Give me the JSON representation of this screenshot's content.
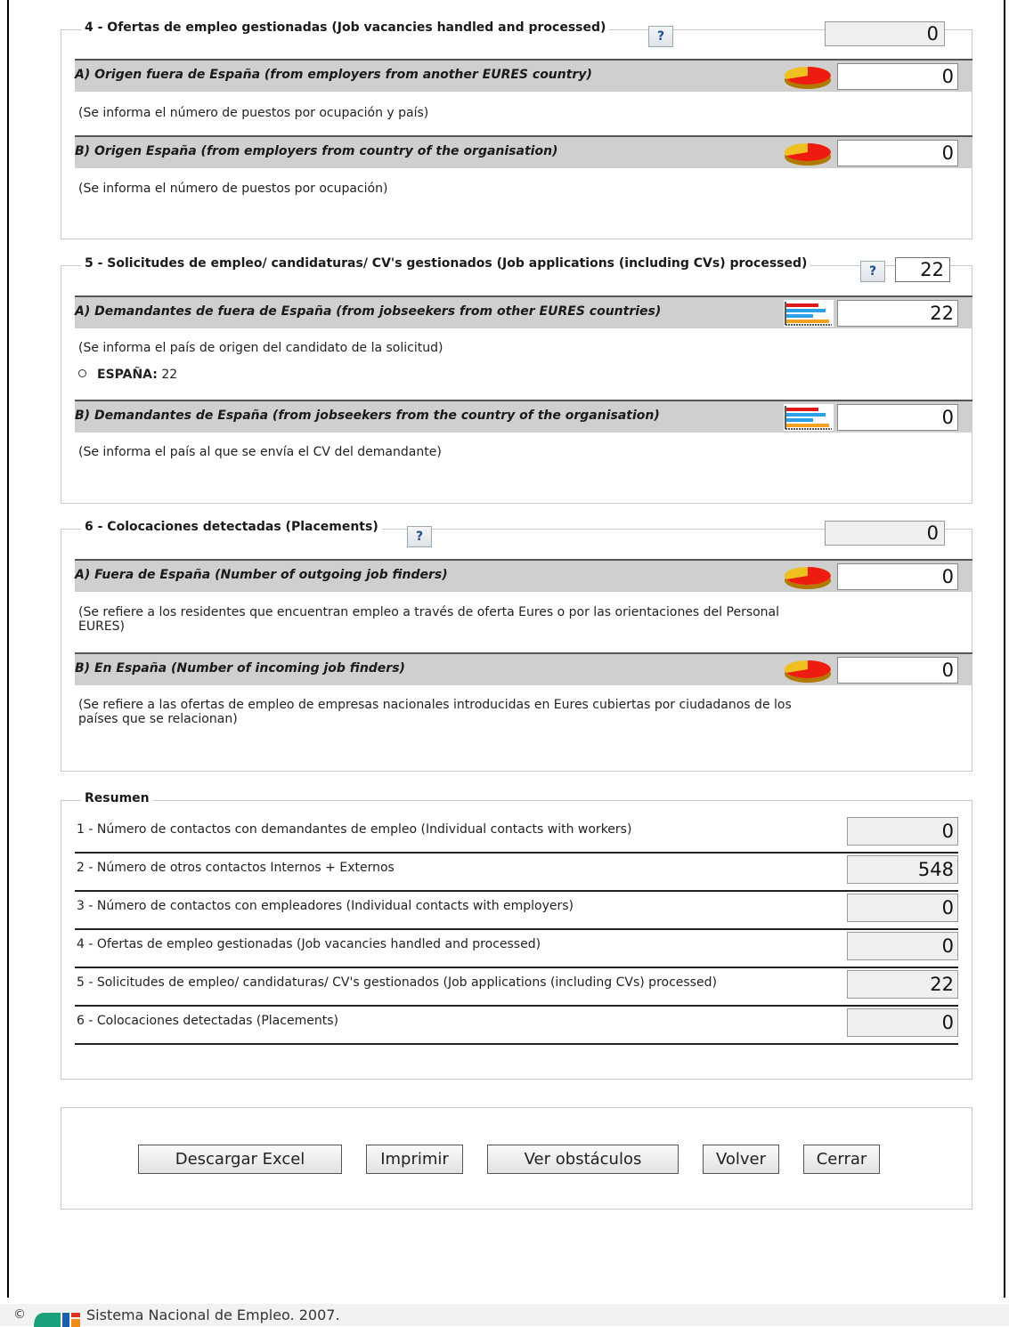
{
  "section4": {
    "title": "4 - Ofertas de empleo gestionadas (Job vacancies handled and processed)",
    "help": "?",
    "total": "0",
    "a": {
      "label": "A) Origen fuera de España (from employers from another EURES country)",
      "value": "0",
      "icon": "pie-chart-icon",
      "note": "(Se informa el número de puestos por ocupación y país)"
    },
    "b": {
      "label": "B) Origen España (from employers from country of the organisation)",
      "value": "0",
      "icon": "pie-chart-icon",
      "note": "(Se informa el número de puestos por ocupación)"
    }
  },
  "section5": {
    "title": "5 - Solicitudes de empleo/ candidaturas/ CV's gestionados (Job applications (including CVs) processed)",
    "help": "?",
    "total": "22",
    "a": {
      "label": "A) Demandantes de fuera de España (from jobseekers from other EURES countries)",
      "value": "22",
      "icon": "bar-chart-icon",
      "note": "(Se informa el país de origen del candidato de la solicitud)",
      "country": "ESPAÑA:",
      "country_value": "22"
    },
    "b": {
      "label": "B) Demandantes de España (from jobseekers from the country of the organisation)",
      "value": "0",
      "icon": "bar-chart-icon",
      "note": "(Se informa el país al que se envía el CV del demandante)"
    }
  },
  "section6": {
    "title": "6 - Colocaciones detectadas (Placements)",
    "help": "?",
    "total": "0",
    "a": {
      "label": "A) Fuera de España (Number of outgoing job finders)",
      "value": "0",
      "icon": "pie-chart-icon",
      "note1": "(Se refiere a los residentes que encuentran empleo a través de oferta Eures o por las orientaciones del Personal",
      "note2": "EURES)"
    },
    "b": {
      "label": "B) En España (Number of incoming job finders)",
      "value": "0",
      "icon": "pie-chart-icon",
      "note1": "(Se refiere a las ofertas de empleo de empresas nacionales introducidas en Eures cubiertas por ciudadanos de los",
      "note2": "países que se relacionan)"
    }
  },
  "summary": {
    "title": "Resumen",
    "rows": [
      {
        "label": "1 - Número de contactos con demandantes de empleo (Individual contacts with workers)",
        "value": "0"
      },
      {
        "label": "2 - Número de otros contactos Internos + Externos",
        "value": "548"
      },
      {
        "label": "3 - Número de contactos con empleadores (Individual contacts with employers)",
        "value": "0"
      },
      {
        "label": "4 - Ofertas de empleo gestionadas (Job vacancies handled and processed)",
        "value": "0"
      },
      {
        "label": "5 - Solicitudes de empleo/ candidaturas/ CV's gestionados (Job applications (including CVs) processed)",
        "value": "22"
      },
      {
        "label": "6 - Colocaciones detectadas (Placements)",
        "value": "0"
      }
    ]
  },
  "buttons": {
    "excel": "Descargar Excel",
    "print": "Imprimir",
    "obstacles": "Ver obstáculos",
    "back": "Volver",
    "close": "Cerrar"
  },
  "footer": {
    "copyright": "©",
    "text": "Sistema Nacional de Empleo. 2007.",
    "logo": "sne-logo"
  }
}
